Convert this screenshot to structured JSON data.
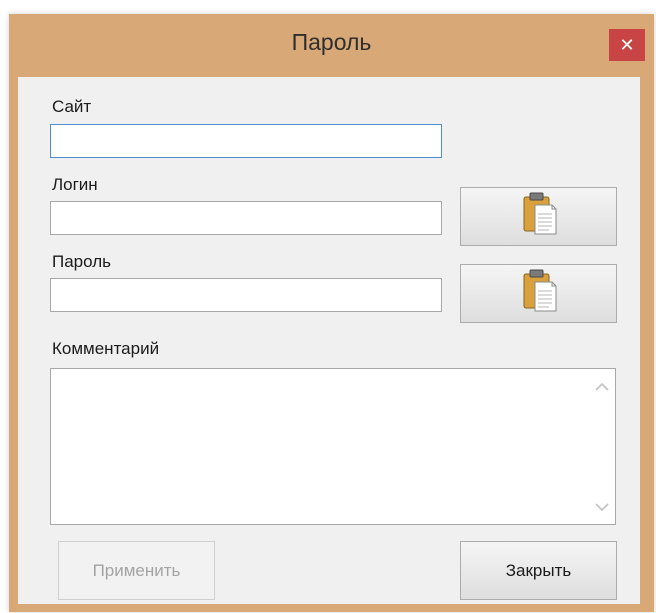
{
  "window": {
    "title": "Пароль",
    "close_icon": "close-icon",
    "colors": {
      "frame": "#d9a877",
      "close": "#c94545",
      "client": "#f0f0f0"
    }
  },
  "form": {
    "site_label": "Сайт",
    "site_value": "",
    "login_label": "Логин",
    "login_value": "",
    "password_label": "Пароль",
    "password_value": "",
    "comment_label": "Комментарий",
    "comment_value": ""
  },
  "buttons": {
    "copy_login_icon": "clipboard-icon",
    "copy_password_icon": "clipboard-icon",
    "apply_label": "Применить",
    "apply_enabled": false,
    "close_label": "Закрыть"
  }
}
